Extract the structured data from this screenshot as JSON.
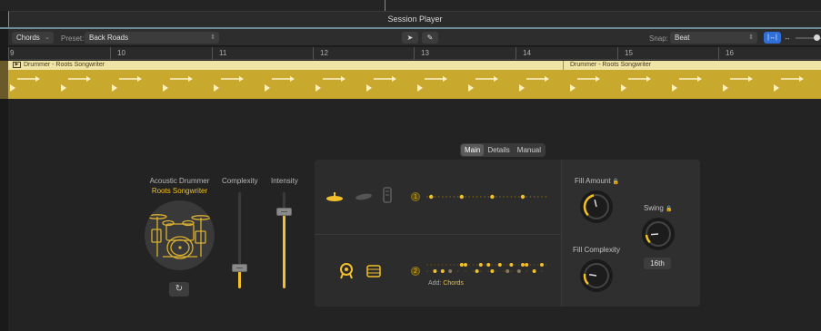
{
  "window": {
    "title": "Session Player"
  },
  "toolbar": {
    "chords_label": "Chords",
    "preset_label": "Preset:",
    "preset_value": "Back Roads",
    "snap_label": "Snap:",
    "snap_value": "Beat",
    "pointer_tool_icon": "pointer-icon",
    "pencil_tool_icon": "pencil-icon"
  },
  "ruler": {
    "bars": [
      "9",
      "10",
      "11",
      "12",
      "13",
      "14",
      "15",
      "16"
    ]
  },
  "regions": [
    {
      "name": "Drummer - Roots Songwriter"
    },
    {
      "name": "Drummer - Roots Songwriter"
    }
  ],
  "tabs": [
    {
      "label": "Main",
      "active": true
    },
    {
      "label": "Details",
      "active": false
    },
    {
      "label": "Manual",
      "active": false
    }
  ],
  "drummer": {
    "name": "Acoustic Drummer",
    "style": "Roots Songwriter"
  },
  "sliders": {
    "complexity": {
      "label": "Complexity",
      "value": 0.22
    },
    "intensity": {
      "label": "Intensity",
      "value": 0.8
    }
  },
  "beat": {
    "row1_number": "1",
    "row2_number": "2",
    "add_label": "Add:",
    "add_value": "Chords"
  },
  "knobs": {
    "fill_amount": {
      "label": "Fill Amount",
      "value": 0.45
    },
    "fill_complexity": {
      "label": "Fill Complexity",
      "value": 0.2
    },
    "swing": {
      "label": "Swing",
      "value": 0.15,
      "note": "16th"
    }
  },
  "colors": {
    "accent": "#f2c02a",
    "region": "#c9a82e",
    "blue": "#2f6fd6"
  }
}
